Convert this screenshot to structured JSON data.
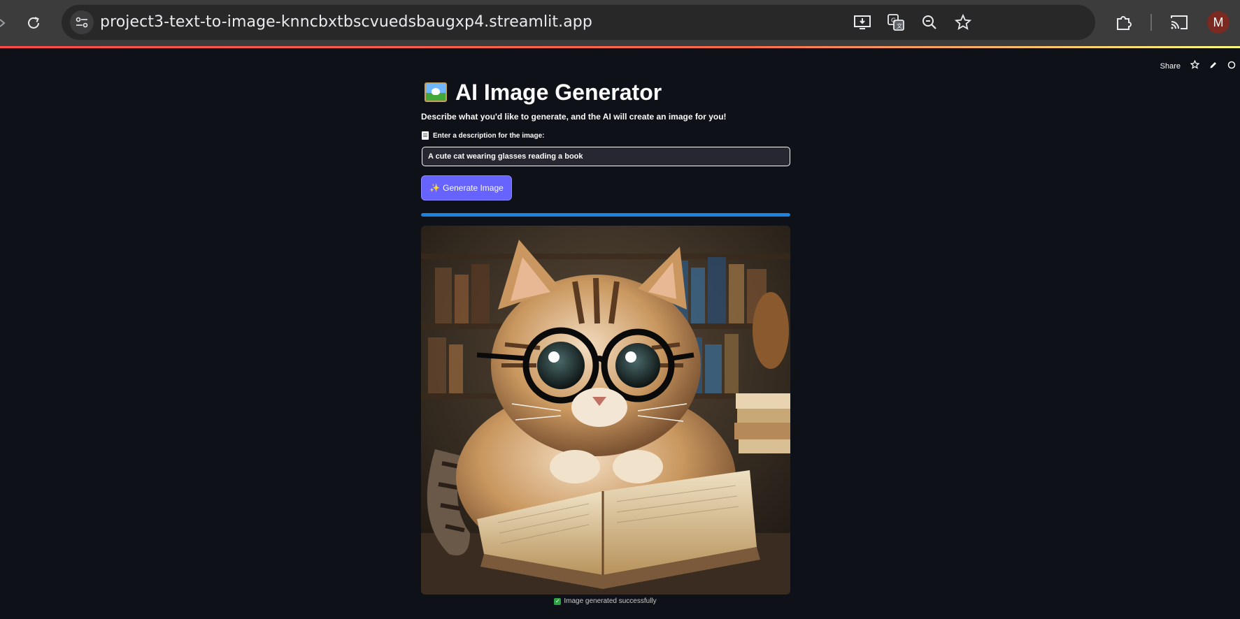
{
  "browser": {
    "url": "project3-text-to-image-knncbxtbscvuedsbaugxp4.streamlit.app",
    "profile_initial": "M",
    "icons": [
      "reload-icon",
      "site-info-icon",
      "install-app-icon",
      "translate-icon",
      "zoom-icon",
      "bookmark-star-icon",
      "extensions-icon",
      "cast-icon"
    ]
  },
  "toolbar": {
    "share_label": "Share",
    "icons": [
      "star-icon",
      "edit-icon",
      "github-icon"
    ]
  },
  "app": {
    "title": "AI Image Generator",
    "description": "Describe what you'd like to generate, and the AI will create an image for you!",
    "input_label": "Enter a description for the image:",
    "input_value": "A cute cat wearing glasses reading a book",
    "generate_label": "Generate Image",
    "progress": 1.0,
    "caption": "Image generated successfully"
  },
  "colors": {
    "background": "#0e1117",
    "accent": "#6663ff",
    "progress": "#1c83e1",
    "success": "#2ea043"
  }
}
